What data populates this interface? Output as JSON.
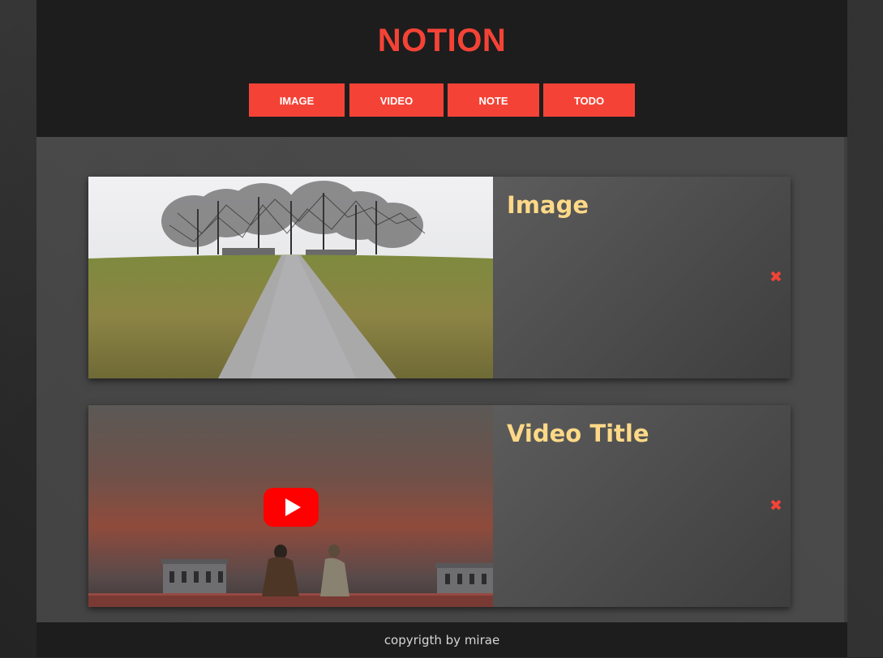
{
  "app": {
    "logo": "NOTION"
  },
  "nav": {
    "items": [
      {
        "label": "IMAGE"
      },
      {
        "label": "VIDEO"
      },
      {
        "label": "NOTE"
      },
      {
        "label": "TODO"
      }
    ]
  },
  "cards": [
    {
      "type": "image",
      "title": "Image",
      "close_icon": "close-icon"
    },
    {
      "type": "video",
      "title": "Video Title",
      "close_icon": "close-icon",
      "media_icon": "youtube-play-icon"
    }
  ],
  "footer": {
    "text": "copyrigth by mirae"
  },
  "colors": {
    "accent": "#f44336",
    "title": "#ffd987",
    "header_bg": "#1d1d1d"
  }
}
